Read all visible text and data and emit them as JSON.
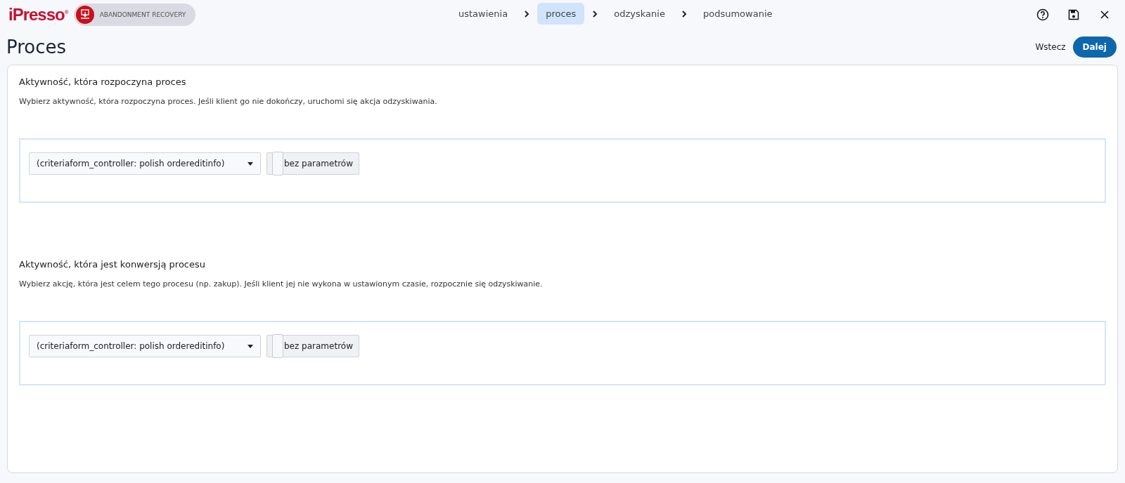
{
  "header": {
    "logo": "iPresso",
    "logo_mark": "®",
    "module_badge": "ABANDONMENT RECOVERY",
    "steps": [
      {
        "label": "ustawienia",
        "selected": false
      },
      {
        "label": "proces",
        "selected": true
      },
      {
        "label": "odzyskanie",
        "selected": false
      },
      {
        "label": "podsumowanie",
        "selected": false
      }
    ]
  },
  "page": {
    "title": "Proces",
    "back_button": "Wstecz",
    "next_button": "Dalej"
  },
  "sections": [
    {
      "title": "Aktywność, która rozpoczyna proces",
      "description": "Wybierz aktywność, która rozpoczyna proces. Jeśli klient go nie dokończy, uruchomi się akcja odzyskiwania.",
      "select_value": "(criteriaform_controller: polish ordereditinfo)",
      "params_button": "bez parametrów"
    },
    {
      "title": "Aktywność, która jest konwersją procesu",
      "description": "Wybierz akcję, która jest celem tego procesu (np. zakup). Jeśli klient jej nie wykona w ustawionym czasie, rozpocznie się odzyskiwanie.",
      "select_value": "(criteriaform_controller: polish ordereditinfo)",
      "params_button": "bez parametrów"
    }
  ]
}
